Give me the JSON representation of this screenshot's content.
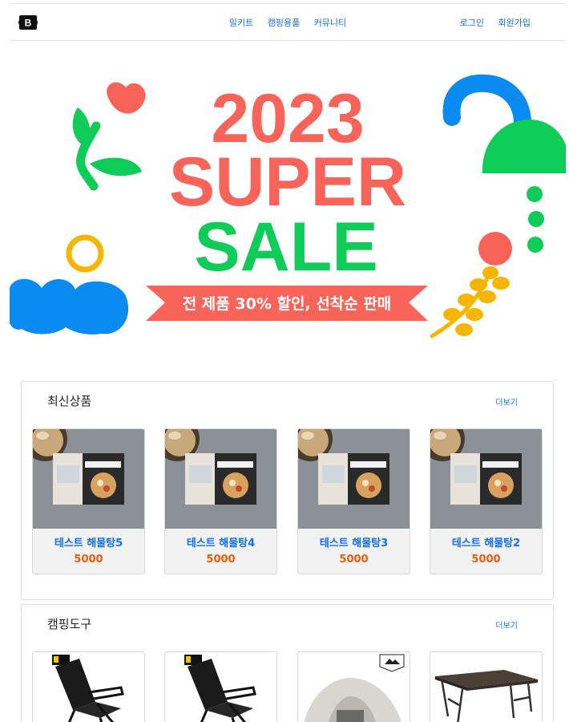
{
  "nav": {
    "brand_letter": "B",
    "links": [
      "밀키트",
      "캠핑용품",
      "커뮤니티"
    ],
    "login": "로그인",
    "signup": "회원가입"
  },
  "banner": {
    "year": "2023",
    "line1": "SUPER",
    "line2": "SALE",
    "ribbon": "전 제품 30% 할인, 선착순 판매"
  },
  "section_new": {
    "title": "최신상품",
    "more": "더보기",
    "products": [
      {
        "name": "테스트 해물탕5",
        "price": "5000"
      },
      {
        "name": "테스트 해물탕4",
        "price": "5000"
      },
      {
        "name": "테스트 해물탕3",
        "price": "5000"
      },
      {
        "name": "테스트 해물탕2",
        "price": "5000"
      }
    ]
  },
  "section_camping": {
    "title": "캠핑도구",
    "more": "더보기"
  },
  "colors": {
    "link": "#0d6efd",
    "price": "#ef5a0a",
    "coral": "#f8635a",
    "green": "#0fcb58",
    "blue": "#0a8bf2",
    "yellow": "#f8b500"
  }
}
